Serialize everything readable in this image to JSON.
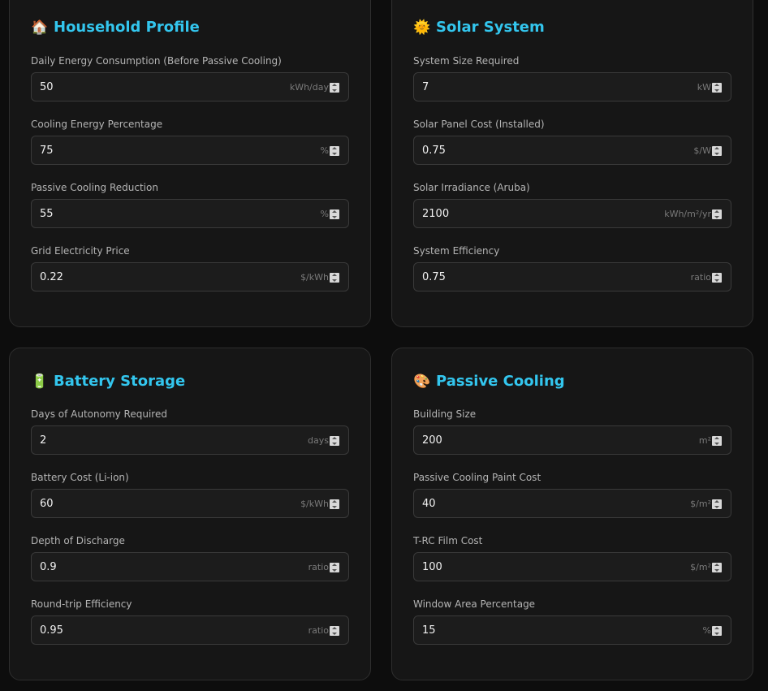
{
  "household": {
    "icon": "house-emoji",
    "emoji": "🏠",
    "title": "Household Profile",
    "fields": [
      {
        "label": "Daily Energy Consumption (Before Passive Cooling)",
        "value": "50",
        "unit": "kWh/day"
      },
      {
        "label": "Cooling Energy Percentage",
        "value": "75",
        "unit": "%"
      },
      {
        "label": "Passive Cooling Reduction",
        "value": "55",
        "unit": "%"
      },
      {
        "label": "Grid Electricity Price",
        "value": "0.22",
        "unit": "$/kWh"
      }
    ]
  },
  "solar": {
    "icon": "sun-emoji",
    "emoji": "🌞",
    "title": "Solar System",
    "fields": [
      {
        "label": "System Size Required",
        "value": "7",
        "unit": "kW"
      },
      {
        "label": "Solar Panel Cost (Installed)",
        "value": "0.75",
        "unit": "$/W"
      },
      {
        "label": "Solar Irradiance (Aruba)",
        "value": "2100",
        "unit": "kWh/m²/yr"
      },
      {
        "label": "System Efficiency",
        "value": "0.75",
        "unit": "ratio"
      }
    ]
  },
  "battery": {
    "icon": "battery-emoji",
    "emoji": "🔋",
    "title": "Battery Storage",
    "fields": [
      {
        "label": "Days of Autonomy Required",
        "value": "2",
        "unit": "days"
      },
      {
        "label": "Battery Cost (Li-ion)",
        "value": "60",
        "unit": "$/kWh"
      },
      {
        "label": "Depth of Discharge",
        "value": "0.9",
        "unit": "ratio"
      },
      {
        "label": "Round-trip Efficiency",
        "value": "0.95",
        "unit": "ratio"
      }
    ]
  },
  "cooling": {
    "icon": "palette-emoji",
    "emoji": "🎨",
    "title": "Passive Cooling",
    "fields": [
      {
        "label": "Building Size",
        "value": "200",
        "unit": "m²"
      },
      {
        "label": "Passive Cooling Paint Cost",
        "value": "40",
        "unit": "$/m²"
      },
      {
        "label": "T-RC Film Cost",
        "value": "100",
        "unit": "$/m²"
      },
      {
        "label": "Window Area Percentage",
        "value": "15",
        "unit": "%"
      }
    ]
  },
  "colors": {
    "accent": "#33c6ee",
    "background": "#0d0d0d",
    "card": "#161616",
    "input": "#1c1c1c"
  }
}
